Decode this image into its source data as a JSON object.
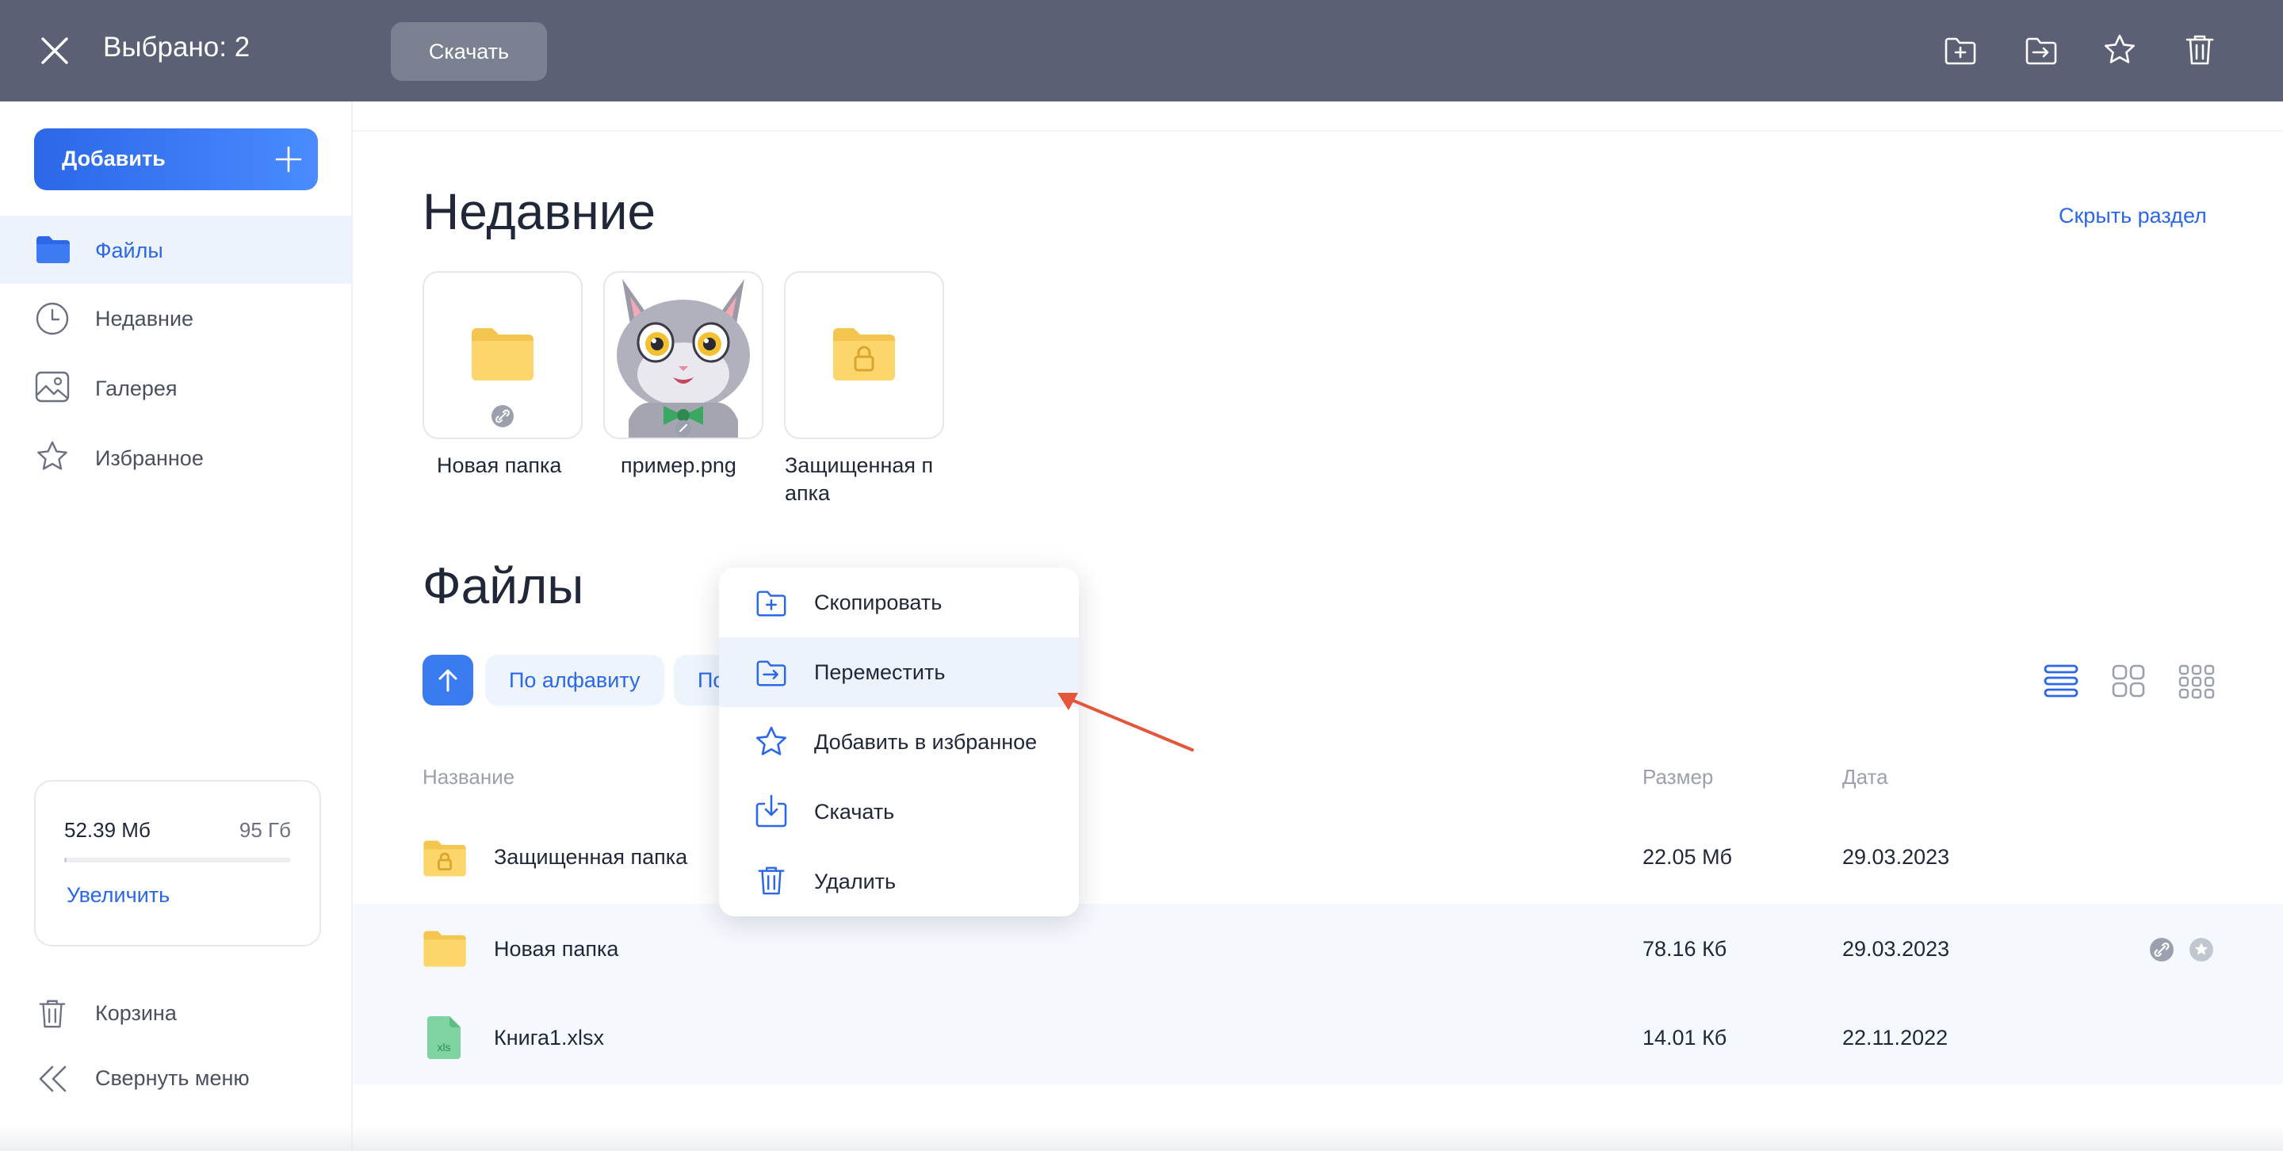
{
  "topbar": {
    "title": "Выбрано: 2",
    "download_label": "Скачать",
    "actions": [
      "copy-to-folder-icon",
      "move-to-folder-icon",
      "star-icon",
      "trash-icon"
    ]
  },
  "sidebar": {
    "add_label": "Добавить",
    "items": [
      {
        "label": "Файлы",
        "icon": "folder-icon",
        "active": true
      },
      {
        "label": "Недавние",
        "icon": "clock-icon",
        "active": false
      },
      {
        "label": "Галерея",
        "icon": "gallery-icon",
        "active": false
      },
      {
        "label": "Избранное",
        "icon": "star-icon",
        "active": false
      }
    ],
    "storage": {
      "used": "52.39 Мб",
      "total": "95 Гб",
      "used_fraction": 0.0006,
      "upgrade_label": "Увеличить"
    },
    "footer": [
      {
        "label": "Корзина",
        "icon": "trash-icon"
      },
      {
        "label": "Свернуть меню",
        "icon": "double-chevron-left-icon"
      }
    ]
  },
  "recent": {
    "title": "Недавние",
    "hide_label": "Скрыть раздел",
    "tiles": [
      {
        "caption": "Новая папка",
        "icon": "folder-icon"
      },
      {
        "caption": "пример.png",
        "icon": "cat-image-thumbnail"
      },
      {
        "caption_line1": "Защищенная п",
        "caption_line2": "апка",
        "icon": "locked-folder-icon"
      }
    ]
  },
  "files": {
    "title": "Файлы",
    "sort_chips": [
      "По алфавиту",
      "По"
    ],
    "columns": {
      "name": "Название",
      "size": "Размер",
      "date": "Дата"
    },
    "rows": [
      {
        "name": "Защищенная папка",
        "size": "22.05 Мб",
        "date": "29.03.2023",
        "icon": "locked-folder-icon",
        "selected": false
      },
      {
        "name": "Новая папка",
        "size": "78.16 Кб",
        "date": "29.03.2023",
        "icon": "folder-icon",
        "selected": true
      },
      {
        "name": "Книга1.xlsx",
        "size": "14.01 Кб",
        "date": "22.11.2022",
        "icon": "xls-file-icon",
        "xls_label": "xls",
        "selected": true
      }
    ],
    "view_modes": [
      "list-view-icon",
      "grid-view-icon",
      "small-grid-view-icon"
    ]
  },
  "context_menu": {
    "items": [
      {
        "label": "Скопировать",
        "icon": "copy-to-folder-icon"
      },
      {
        "label": "Переместить",
        "icon": "move-to-folder-icon",
        "highlighted": true
      },
      {
        "label": "Добавить в избранное",
        "icon": "star-icon"
      },
      {
        "label": "Скачать",
        "icon": "download-icon"
      },
      {
        "label": "Удалить",
        "icon": "trash-icon"
      }
    ]
  },
  "colors": {
    "topbar": "#5b6075",
    "accent": "#2b67e8",
    "folder": "#fcd66b",
    "arrow": "#e5553a",
    "xls": "#7ed4a0"
  }
}
